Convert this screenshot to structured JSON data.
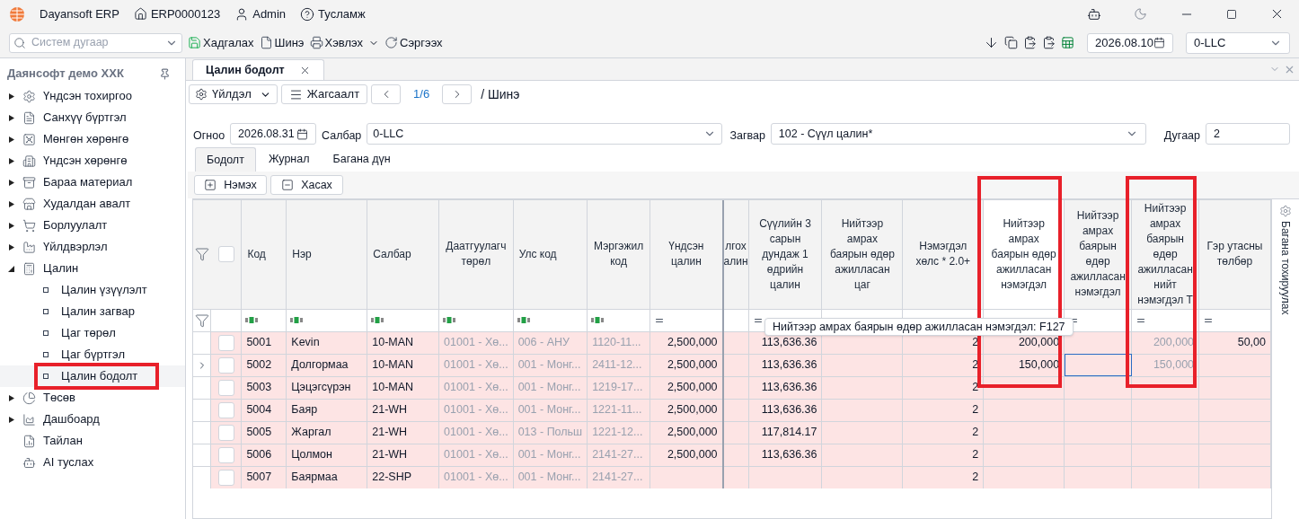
{
  "titlebar": {
    "app_name": "Dayansoft ERP",
    "document_number": "ERP0000123",
    "user": "Admin",
    "help": "Тусламж"
  },
  "toolbar": {
    "search": {
      "placeholder": "Систем дугаар"
    },
    "actions": [
      {
        "label": "Хадгалах",
        "kind": "save"
      },
      {
        "label": "Шинэ",
        "kind": "new"
      },
      {
        "label": "Хэвлэх",
        "kind": "print"
      },
      {
        "label": "Сэргээх",
        "kind": "refresh"
      }
    ],
    "date": "2026.08.10",
    "company": "0-LLC"
  },
  "sidebar": {
    "title": "Даянсофт демо ХХК",
    "items": [
      {
        "label": "Үндсэн тохиргоо",
        "expandable": true,
        "expanded": false
      },
      {
        "label": "Санхүү бүртгэл",
        "expandable": true,
        "expanded": false
      },
      {
        "label": "Мөнгөн хөрөнгө",
        "expandable": true,
        "expanded": false
      },
      {
        "label": "Үндсэн хөрөнгө",
        "expandable": true,
        "expanded": false
      },
      {
        "label": "Бараа материал",
        "expandable": true,
        "expanded": false
      },
      {
        "label": "Худалдан авалт",
        "expandable": true,
        "expanded": false
      },
      {
        "label": "Борлуулалт",
        "expandable": true,
        "expanded": false
      },
      {
        "label": "Үйлдвэрлэл",
        "expandable": true,
        "expanded": false
      },
      {
        "label": "Цалин",
        "expandable": true,
        "expanded": true,
        "children": [
          {
            "label": "Цалин үзүүлэлт",
            "selected": false
          },
          {
            "label": "Цалин загвар",
            "selected": false
          },
          {
            "label": "Цаг төрөл",
            "selected": false
          },
          {
            "label": "Цаг бүртгэл",
            "selected": false
          },
          {
            "label": "Цалин бодолт",
            "selected": true,
            "annotated": true
          }
        ]
      },
      {
        "label": "Төсөв",
        "expandable": true,
        "expanded": false
      },
      {
        "label": "Дашбоард",
        "expandable": true,
        "expanded": false
      },
      {
        "label": "Тайлан",
        "expandable": false
      },
      {
        "label": "AI туслах",
        "expandable": false
      }
    ]
  },
  "document_tab": {
    "title": "Цалин бодолт"
  },
  "action_bar": {
    "actions_menu": "Үйлдэл",
    "list_button": "Жагсаалт",
    "pager": "1/6",
    "status": "/ Шинэ"
  },
  "form": {
    "date_label": "Огноо",
    "date": "2026.08.31",
    "branch_label": "Салбар",
    "branch": "0-LLC",
    "template_label": "Загвар",
    "template": "102 - Сүүл цалин*",
    "number_label": "Дугаар",
    "number": "2"
  },
  "tabs": [
    {
      "label": "Бодолт",
      "selected": true
    },
    {
      "label": "Журнал",
      "selected": false
    },
    {
      "label": "Багана дүн",
      "selected": false
    }
  ],
  "grid_buttons": [
    {
      "label": "Нэмэх",
      "kind": "add"
    },
    {
      "label": "Хасах",
      "kind": "remove"
    }
  ],
  "grid": {
    "select_all_checked": false,
    "tooltip": "Нийтээр амрах баярын өдөр ажилласан нэмэгдэл: F127",
    "side_panel": "Багана тохируулах",
    "columns": [
      {
        "label": "Код",
        "kind": "text",
        "filterable": true,
        "selected": false
      },
      {
        "label": "Нэр",
        "kind": "text",
        "filterable": true,
        "selected": false
      },
      {
        "label": "Салбар",
        "kind": "text",
        "filterable": true,
        "selected": false
      },
      {
        "label": "Даатгуулагч төрөл",
        "kind": "text",
        "filterable": true,
        "muted": true,
        "selected": false
      },
      {
        "label": "Улс код",
        "kind": "text",
        "filterable": true,
        "muted": true,
        "selected": false
      },
      {
        "label": "Мэргэжил код",
        "kind": "text",
        "filterable": true,
        "muted": true,
        "selected": false
      },
      {
        "label": "Үндсэн цалин",
        "kind": "number",
        "filterable": true,
        "selected": false
      },
      {
        "label": "лгох алин",
        "kind": "number",
        "filterable": false,
        "selected": false
      },
      {
        "label": "Сүүлийн 3 сарын дундаж 1 өдрийн цалин",
        "kind": "number",
        "filterable": true,
        "selected": false
      },
      {
        "label": "Нийтээр амрах баярын өдөр ажилласан цаг",
        "kind": "number",
        "selected": false
      },
      {
        "label": "Нэмэгдэл хөлс * 2.0+",
        "kind": "number",
        "selected": false
      },
      {
        "label": "Нийтээр амрах баярын өдөр ажилласан нэмэгдэл",
        "kind": "number",
        "filterable": false,
        "selected": true,
        "annotated": true
      },
      {
        "label": "Нийтээр амрах баярын өдөр ажилласан нэмэгдэл",
        "kind": "number",
        "filterable": true,
        "selected": false,
        "focused": true
      },
      {
        "label": "Нийтээр амрах баярын өдөр ажилласан нийт нэмэгдэл Т",
        "kind": "number",
        "filterable": true,
        "muted": true,
        "selected": false,
        "annotated": true
      },
      {
        "label": "Гэр утасны төлбөр",
        "kind": "number",
        "filterable": true,
        "selected": false
      }
    ],
    "rows": [
      {
        "selected": false,
        "checked": false,
        "cells": [
          "5001",
          "Kevin",
          "10-MAN",
          "01001 - Хө...",
          "006 - АНУ",
          "1120-11...",
          "2,500,000",
          null,
          "113,636.36",
          null,
          "2",
          "200,000",
          null,
          "200,000",
          "50,00"
        ]
      },
      {
        "selected": true,
        "checked": false,
        "cells": [
          "5002",
          "Долгормаа",
          "10-MAN",
          "01001 - Хө...",
          "001 - Монг...",
          "2411-12...",
          "2,500,000",
          null,
          "113,636.36",
          null,
          "2",
          "150,000",
          null,
          "150,000",
          null
        ]
      },
      {
        "selected": false,
        "checked": false,
        "cells": [
          "5003",
          "Цэцэгсүрэн",
          "10-MAN",
          "01001 - Хө...",
          "001 - Монг...",
          "1219-17...",
          "2,500,000",
          null,
          "113,636.36",
          null,
          "2",
          null,
          null,
          null,
          null
        ]
      },
      {
        "selected": false,
        "checked": false,
        "cells": [
          "5004",
          "Баяр",
          "21-WH",
          "01001 - Хө...",
          "001 - Монг...",
          "1221-11...",
          "2,500,000",
          null,
          "113,636.36",
          null,
          "2",
          null,
          null,
          null,
          null
        ]
      },
      {
        "selected": false,
        "checked": false,
        "cells": [
          "5005",
          "Жаргал",
          "21-WH",
          "01001 - Хө...",
          "013 - Польш",
          "1221-12...",
          "2,500,000",
          null,
          "117,814.17",
          null,
          "2",
          null,
          null,
          null,
          null
        ]
      },
      {
        "selected": false,
        "checked": false,
        "cells": [
          "5006",
          "Цолмон",
          "21-WH",
          "01001 - Хө...",
          "001 - Монг...",
          "2141-27...",
          "2,500,000",
          null,
          "113,636.36",
          null,
          "2",
          null,
          null,
          null,
          null
        ]
      },
      {
        "selected": false,
        "checked": false,
        "cells": [
          "5007",
          "Баярмаа",
          "22-SHP",
          "01001 - Хө...",
          "001 - Монг...",
          "2141-27...",
          null,
          null,
          null,
          null,
          "2",
          null,
          null,
          null,
          null
        ]
      }
    ]
  }
}
